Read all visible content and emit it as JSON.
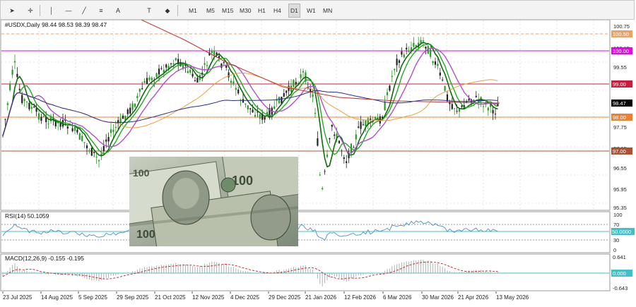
{
  "toolbar": {
    "tools": [
      "cursor-icon",
      "crosshair-icon",
      "vertical-line-icon",
      "horizontal-line-icon",
      "trendline-icon",
      "fibonacci-icon",
      "text-icon",
      "text-label-icon",
      "shapes-icon"
    ],
    "timeframes": [
      "M1",
      "M5",
      "M15",
      "M30",
      "H1",
      "H4",
      "D1",
      "W1",
      "MN"
    ],
    "active_timeframe": "D1"
  },
  "main_chart": {
    "header": "#USDX,Daily  98.44 98.53 98.39 98.47",
    "price_axis": [
      "100.75",
      "100.50",
      "100.15",
      "100.00",
      "99.55",
      "99.00",
      "98.47",
      "98.00",
      "97.75",
      "97.15",
      "97.00",
      "96.55",
      "95.95",
      "95.35"
    ],
    "level_labels": [
      {
        "text": "100.50",
        "color": "#f0a060"
      },
      {
        "text": "100.00",
        "color": "#ee00ee"
      },
      {
        "text": "99.00",
        "color": "#c81e3c"
      },
      {
        "text": "98.47",
        "color": "#000000"
      },
      {
        "text": "98.00",
        "color": "#f08030"
      },
      {
        "text": "97.00",
        "color": "#b05030"
      }
    ]
  },
  "rsi_panel": {
    "header": "RSI(14) 50.1059",
    "axis": [
      "100",
      "70",
      "50.0000",
      "30",
      "0"
    ]
  },
  "macd_panel": {
    "header": "MACD(12,26,9) -0.155 -0.195",
    "axis": [
      "0.641",
      "0.000",
      "-0.643"
    ]
  },
  "time_axis": [
    "23 Jul 2025",
    "14 Aug 2025",
    "5 Sep 2025",
    "29 Sep 2025",
    "21 Oct 2025",
    "12 Nov 2025",
    "4 Dec 2025",
    "29 Dec 2025",
    "21 Jan 2026",
    "12 Feb 2026",
    "6 Mar 2026",
    "30 Mar 2026",
    "21 Apr 2026",
    "13 May 2026"
  ],
  "colors": {
    "bull": "#2a9a2a",
    "bear": "#222222",
    "ma_green": "#22aa22",
    "ma_purple": "#b050c8",
    "ma_orange": "#e8a040",
    "ma_navy": "#2a2a90",
    "ma_red": "#c83030",
    "rsi": "#4a90c0",
    "macd_hist": "#b0b0b0",
    "macd_signal": "#c02020"
  }
}
